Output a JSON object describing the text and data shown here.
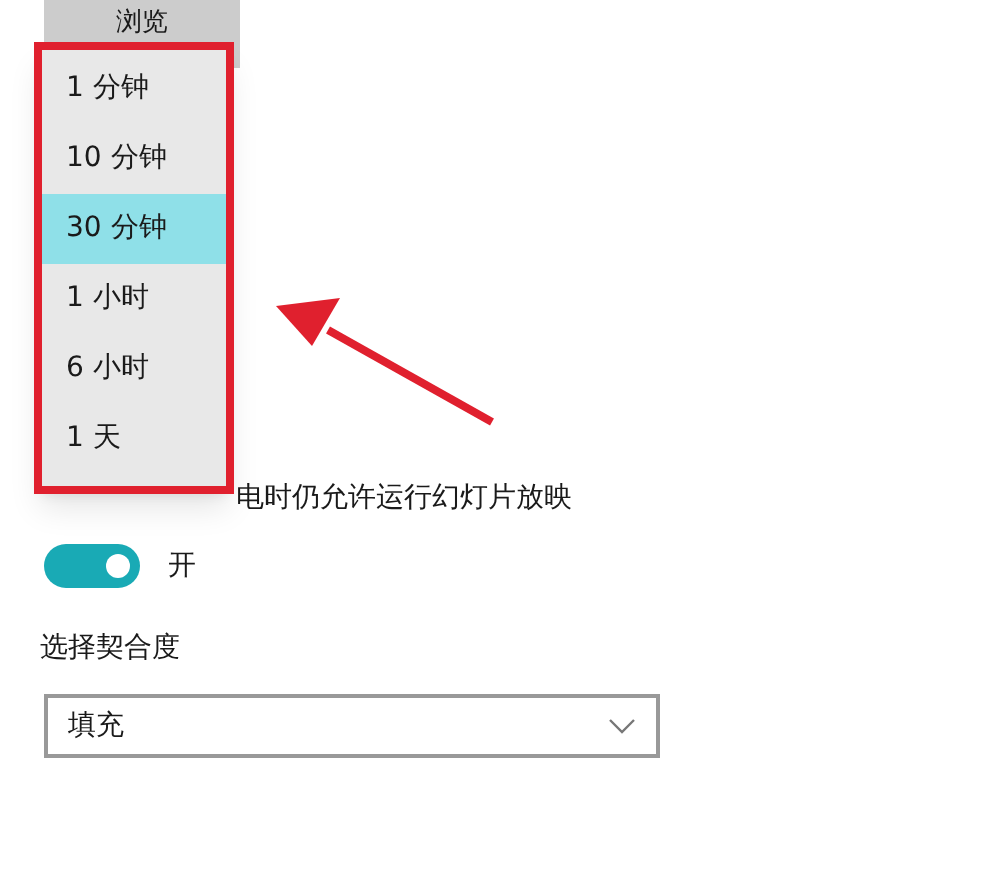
{
  "browse_button": {
    "label": "浏览"
  },
  "dropdown_menu": {
    "options": [
      {
        "label": "1 分钟",
        "selected": false
      },
      {
        "label": "10 分钟",
        "selected": false
      },
      {
        "label": "30 分钟",
        "selected": true
      },
      {
        "label": "1 小时",
        "selected": false
      },
      {
        "label": "6 小时",
        "selected": false
      },
      {
        "label": "1 天",
        "selected": false
      }
    ]
  },
  "battery_slideshow": {
    "label": "电时仍允许运行幻灯片放映",
    "on": true,
    "state_label": "开"
  },
  "fit": {
    "label": "选择契合度",
    "value": "填充"
  }
}
